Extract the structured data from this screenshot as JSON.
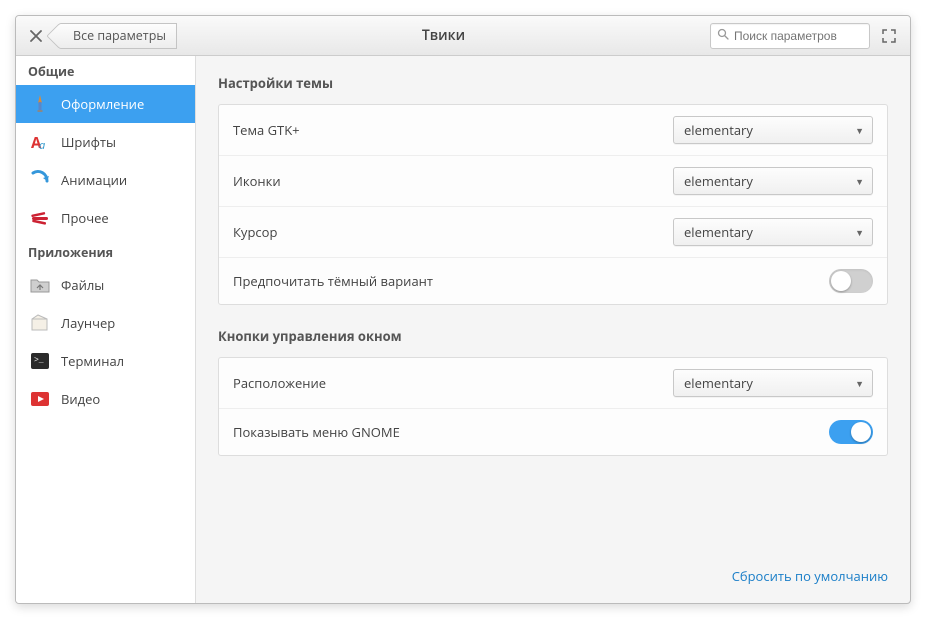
{
  "header": {
    "title": "Твики",
    "breadcrumb": "Все параметры",
    "search_placeholder": "Поиск параметров"
  },
  "sidebar": {
    "groups": [
      {
        "title": "Общие",
        "items": [
          {
            "label": "Оформление",
            "icon": "appearance",
            "active": true
          },
          {
            "label": "Шрифты",
            "icon": "fonts",
            "active": false
          },
          {
            "label": "Анимации",
            "icon": "animations",
            "active": false
          },
          {
            "label": "Прочее",
            "icon": "misc",
            "active": false
          }
        ]
      },
      {
        "title": "Приложения",
        "items": [
          {
            "label": "Файлы",
            "icon": "files",
            "active": false
          },
          {
            "label": "Лаунчер",
            "icon": "launcher",
            "active": false
          },
          {
            "label": "Терминал",
            "icon": "terminal",
            "active": false
          },
          {
            "label": "Видео",
            "icon": "video",
            "active": false
          }
        ]
      }
    ]
  },
  "sections": {
    "theme": {
      "title": "Настройки темы",
      "rows": {
        "gtk": {
          "label": "Тема GTK+",
          "value": "elementary"
        },
        "icons": {
          "label": "Иконки",
          "value": "elementary"
        },
        "cursor": {
          "label": "Курсор",
          "value": "elementary"
        },
        "dark": {
          "label": "Предпочитать тёмный вариант",
          "on": false
        }
      }
    },
    "window": {
      "title": "Кнопки управления окном",
      "rows": {
        "layout": {
          "label": "Расположение",
          "value": "elementary"
        },
        "gnome_menu": {
          "label": "Показывать меню GNOME",
          "on": true
        }
      }
    }
  },
  "footer": {
    "reset": "Сбросить по умолчанию"
  }
}
